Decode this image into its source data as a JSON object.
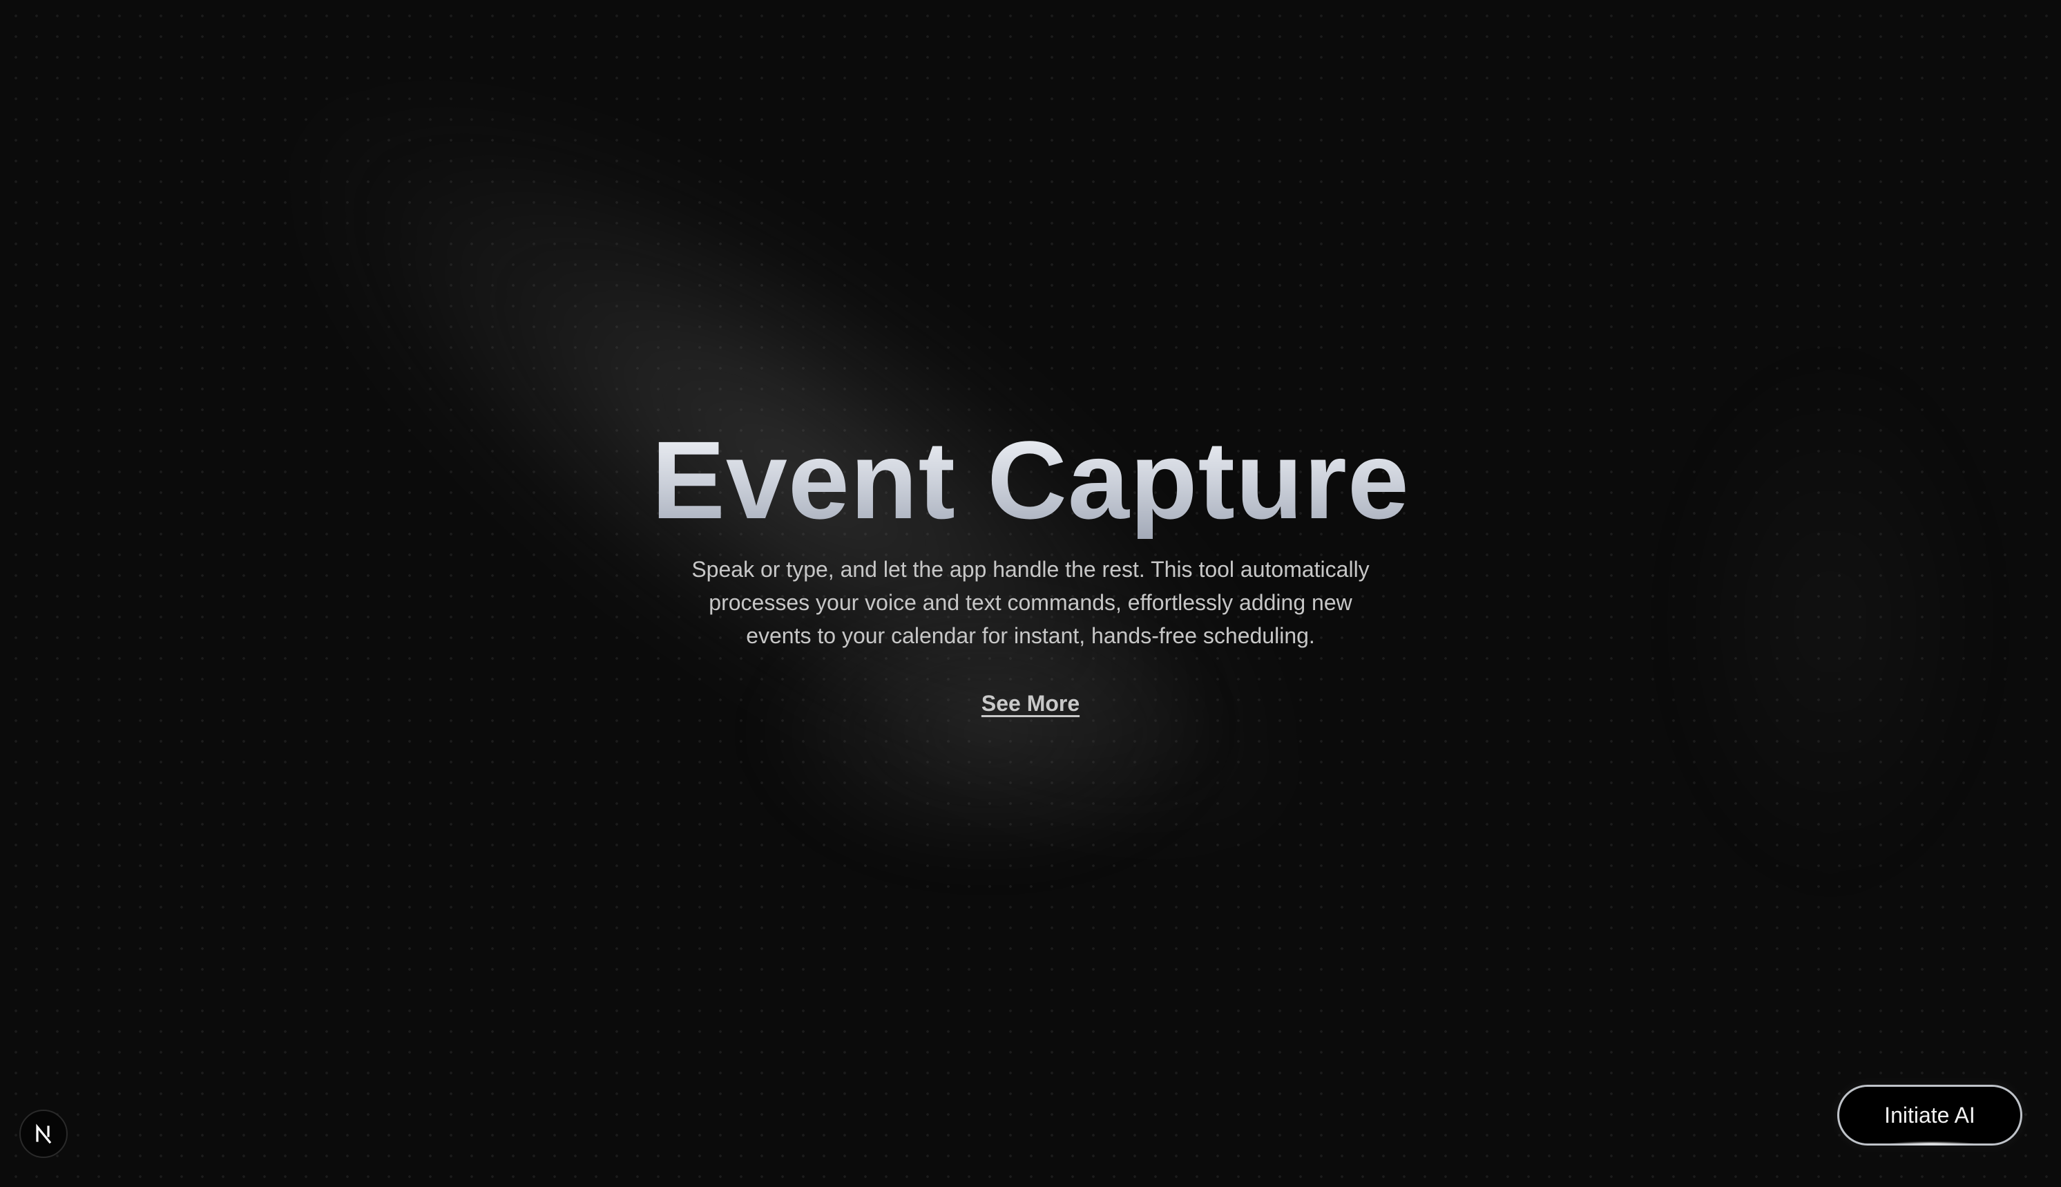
{
  "hero": {
    "title": "Event Capture",
    "description": "Speak or type, and let the app handle the rest. This tool automatically processes your voice and text commands, effortlessly adding new events to your calendar for instant, hands-free scheduling.",
    "see_more_label": "See More"
  },
  "badge": {
    "letter": "N",
    "icon": "n-logo-icon"
  },
  "ai_button": {
    "label": "Initiate AI"
  },
  "colors": {
    "background": "#0b0b0b",
    "title_gradient_top": "#f4f6fa",
    "title_gradient_bottom": "#a3aab8",
    "body_text": "#c7c7c7",
    "button_border": "#bfc3c9"
  }
}
